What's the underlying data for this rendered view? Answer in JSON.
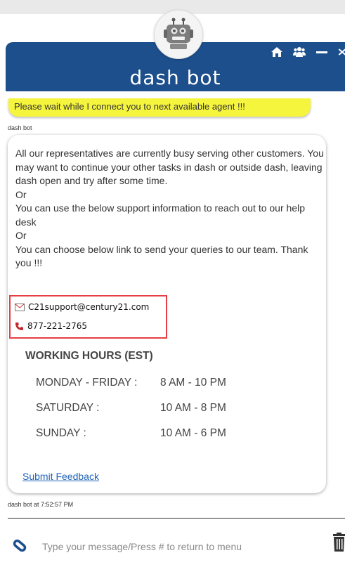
{
  "header": {
    "title": "dash bot",
    "icons": [
      "home-icon",
      "users-icon",
      "minimize-icon",
      "close-icon"
    ]
  },
  "banner": {
    "text": "Please wait while I connect you to next available agent !!!"
  },
  "message": {
    "sender": "dash bot",
    "paragraphs": [
      "All our representatives are currently busy serving other customers. You may want to continue your other tasks in dash or outside dash, leaving dash open and try after some time.",
      "Or",
      "You can use the below support information to reach out to our help desk",
      "Or",
      "You can choose below link to send your queries to our team. Thank you !!!"
    ],
    "email": "C21support@century21.com",
    "phone": "877-221-2765",
    "hours_title": "WORKING HOURS (EST)",
    "hours": [
      {
        "day": "MONDAY - FRIDAY :",
        "time": "8 AM - 10 PM"
      },
      {
        "day": "SATURDAY :",
        "time": "10 AM - 8 PM"
      },
      {
        "day": "SUNDAY :",
        "time": "10 AM - 6 PM"
      }
    ],
    "feedback_link": "Submit Feedback",
    "timestamp": "dash bot at 7:52:57 PM"
  },
  "input": {
    "placeholder": "Type your message/Press # to return to menu"
  },
  "colors": {
    "header_bg": "#1c4f8c",
    "banner_bg": "#f6f53e",
    "highlight_border": "#e53f44",
    "link": "#1f63b8"
  }
}
